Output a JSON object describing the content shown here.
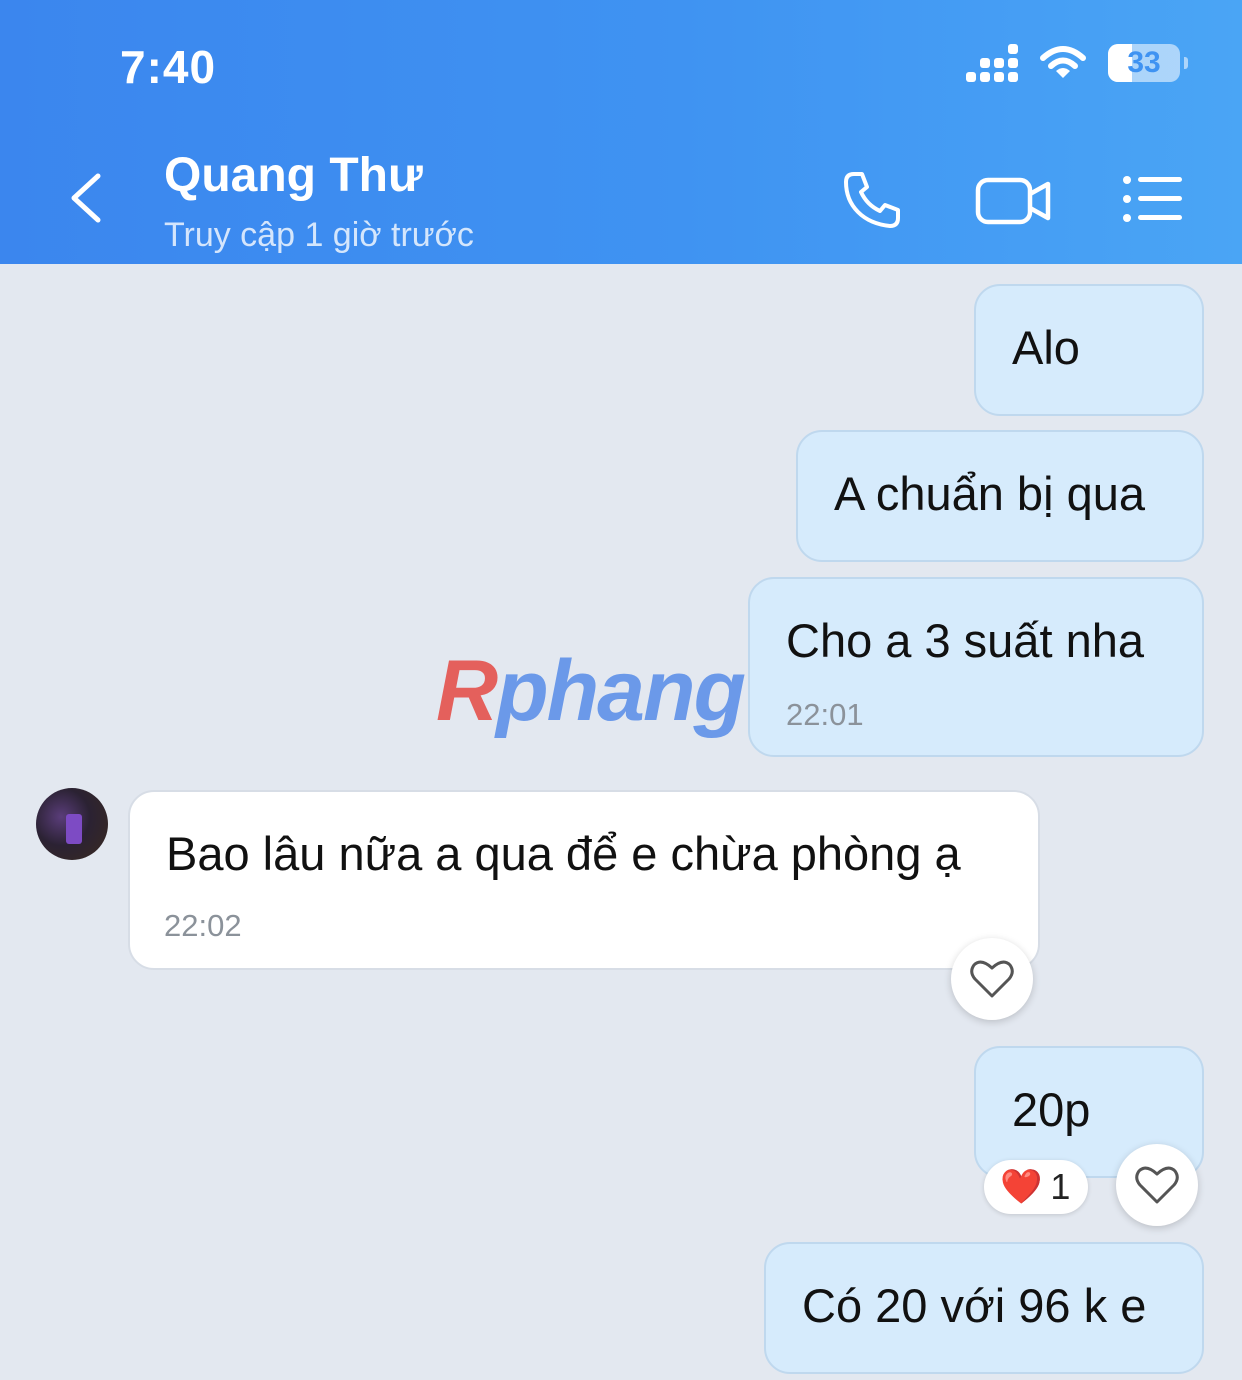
{
  "status_bar": {
    "time": "7:40",
    "battery": "33"
  },
  "header": {
    "contact_name": "Quang Thư",
    "contact_status": "Truy cập 1 giờ trước",
    "icons": [
      "back-icon",
      "phone-icon",
      "video-call-icon",
      "menu-icon"
    ]
  },
  "messages": [
    {
      "direction": "outgoing",
      "text": "Alo"
    },
    {
      "direction": "outgoing",
      "text": "A chuẩn bị qua"
    },
    {
      "direction": "outgoing",
      "text": "Cho a 3 suất nha",
      "time": "22:01"
    },
    {
      "direction": "incoming",
      "text": "Bao lâu nữa a qua để e chừa phòng ạ",
      "time": "22:02"
    },
    {
      "direction": "outgoing",
      "text": "20p",
      "reaction": {
        "emoji": "❤️",
        "count": "1"
      }
    },
    {
      "direction": "outgoing",
      "text": "Có 20 với 96 k e"
    }
  ],
  "watermark": {
    "first_letter": "R",
    "rest": "phang"
  },
  "colors": {
    "header": "#3f93f2",
    "outgoing_bubble": "#d6ebfc",
    "incoming_bubble": "#ffffff",
    "chat_bg": "#e3e8f0"
  }
}
